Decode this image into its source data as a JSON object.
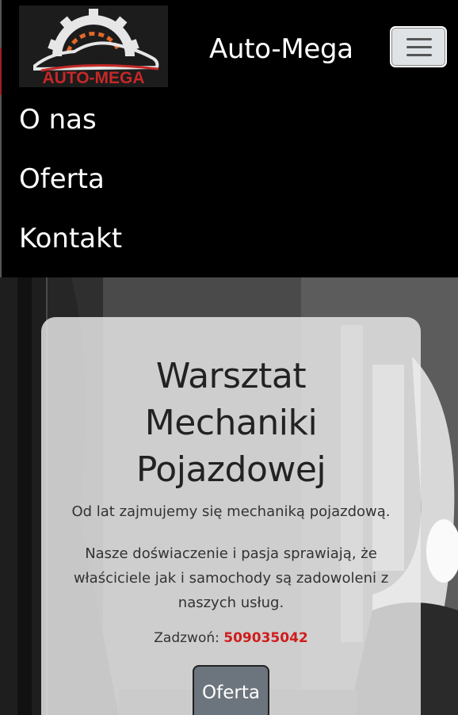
{
  "header": {
    "logo_text": "AUTO-MEGA",
    "brand": "Auto-Mega",
    "toggler_icon": "hamburger-icon"
  },
  "nav": {
    "items": [
      {
        "label": "O nas"
      },
      {
        "label": "Oferta"
      },
      {
        "label": "Kontakt"
      }
    ]
  },
  "hero": {
    "title_lines": [
      "Warsztat",
      "Mechaniki",
      "Pojazdowej"
    ],
    "lead": "Od lat zajmujemy się mechaniką pojazdową.",
    "description": "Nasze doświaczenie i pasja sprawiają, że właściciele jak i samochody są zadowoleni z naszych usług.",
    "phone_label": "Zadzwoń:",
    "phone_number": "509035042",
    "cta_label": "Oferta"
  },
  "colors": {
    "navbar_bg": "#000000",
    "phone_accent": "#d01c1c",
    "button_bg": "#6c757d",
    "logo_red": "#c62828"
  }
}
